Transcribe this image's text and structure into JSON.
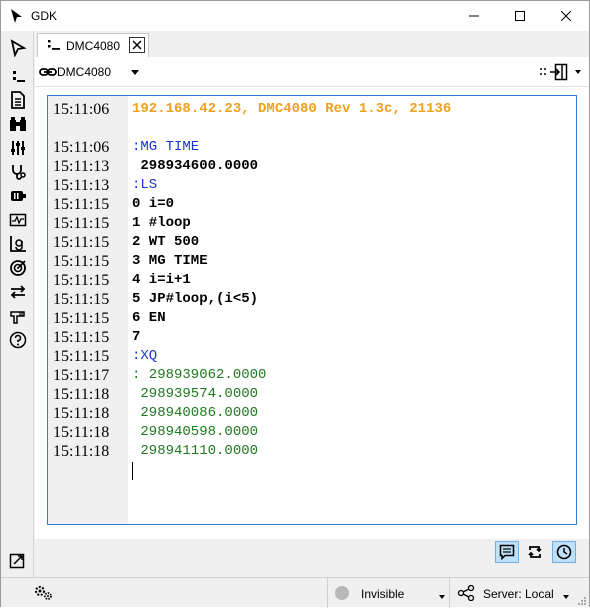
{
  "window": {
    "title": "GDK"
  },
  "tab": {
    "label": "DMC4080"
  },
  "controller": {
    "selected": "DMC4080"
  },
  "terminal": {
    "lines": [
      {
        "time": "15:11:06",
        "text": "192.168.42.23, DMC4080 Rev 1.3c, 21136",
        "style": "orange"
      },
      {
        "time": "",
        "text": "",
        "style": "black"
      },
      {
        "time": "15:11:06",
        "text": ":MG TIME",
        "style": "blue"
      },
      {
        "time": "15:11:13",
        "text": " 298934600.0000",
        "style": "black"
      },
      {
        "time": "15:11:13",
        "text": ":LS",
        "style": "blue"
      },
      {
        "time": "15:11:15",
        "text": "0 i=0",
        "style": "black"
      },
      {
        "time": "15:11:15",
        "text": "1 #loop",
        "style": "black"
      },
      {
        "time": "15:11:15",
        "text": "2 WT 500",
        "style": "black"
      },
      {
        "time": "15:11:15",
        "text": "3 MG TIME",
        "style": "black"
      },
      {
        "time": "15:11:15",
        "text": "4 i=i+1",
        "style": "black"
      },
      {
        "time": "15:11:15",
        "text": "5 JP#loop,(i<5)",
        "style": "black"
      },
      {
        "time": "15:11:15",
        "text": "6 EN",
        "style": "black"
      },
      {
        "time": "15:11:15",
        "text": "7",
        "style": "black"
      },
      {
        "time": "15:11:15",
        "text": ":XQ",
        "style": "blue"
      },
      {
        "time": "15:11:17",
        "text": ": 298939062.0000",
        "style": "green"
      },
      {
        "time": "15:11:18",
        "text": " 298939574.0000",
        "style": "green"
      },
      {
        "time": "15:11:18",
        "text": " 298940086.0000",
        "style": "green"
      },
      {
        "time": "15:11:18",
        "text": " 298940598.0000",
        "style": "green"
      },
      {
        "time": "15:11:18",
        "text": " 298941110.0000",
        "style": "green"
      }
    ]
  },
  "statusbar": {
    "visibility": "Invisible",
    "server": "Server: Local"
  },
  "colors": {
    "accent": "#2f7fd0",
    "orange": "#f0a020",
    "blue": "#1a36d6",
    "green": "#1e7a1e"
  }
}
